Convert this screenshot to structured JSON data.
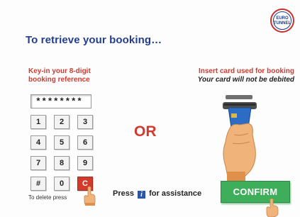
{
  "logo": {
    "line1": "EURO",
    "line2": "TUNNEL"
  },
  "title": "To retrieve your booking…",
  "keypad_section": {
    "label_line1": "Key-in your 8-digit",
    "label_line2": "booking reference",
    "field_value": "********",
    "keys": [
      "1",
      "2",
      "3",
      "4",
      "5",
      "6",
      "7",
      "8",
      "9",
      "#",
      "0",
      "C"
    ],
    "delete_note": "To delete press"
  },
  "or_text": "OR",
  "card_section": {
    "label_line1": "Insert card used for booking",
    "label_line2": "Your card will not be debited"
  },
  "assist": {
    "prefix": "Press",
    "icon_glyph": "i",
    "suffix": "for assistance"
  },
  "confirm_label": "CONFIRM",
  "colors": {
    "title": "#243e8f",
    "accent_red": "#d13a2f",
    "confirm_green": "#3fae5b"
  },
  "icons": {
    "logo": "eurotunnel-logo-icon",
    "info": "info-icon",
    "card": "card-slot-icon",
    "hand": "pointing-hand-icon"
  }
}
